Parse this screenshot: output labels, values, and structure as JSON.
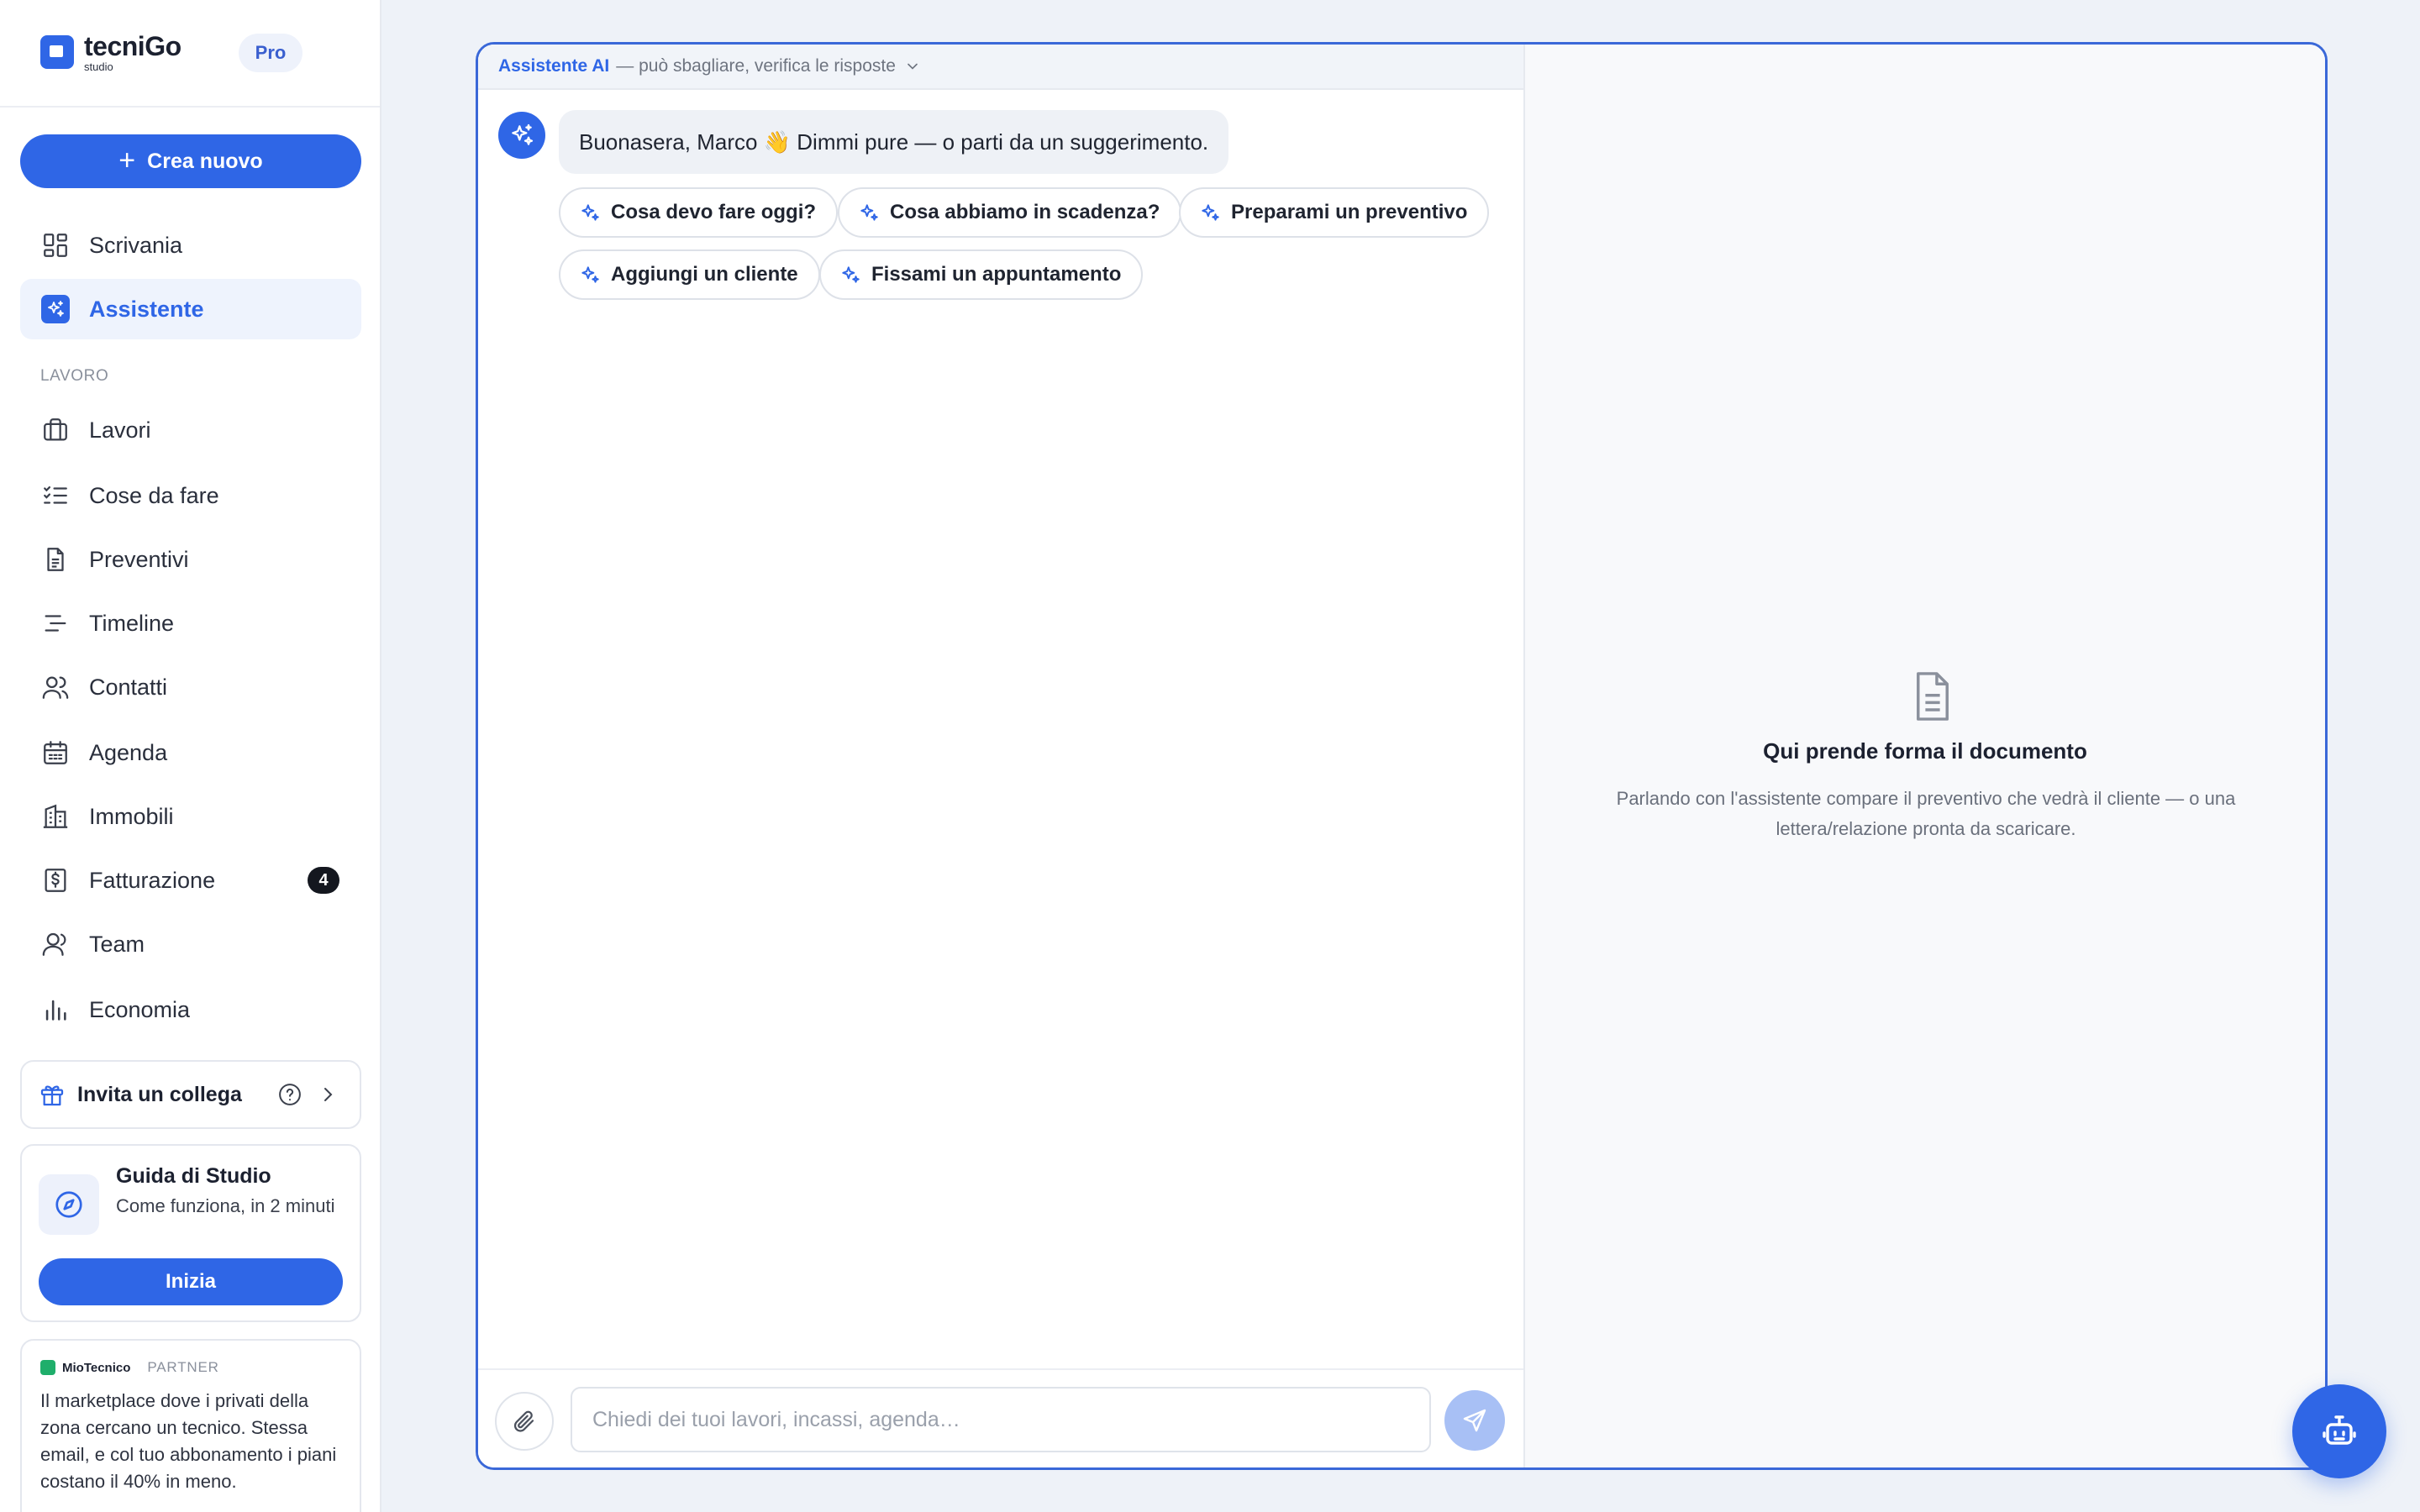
{
  "brand": {
    "name": "tecniGo",
    "sub": "studio",
    "plan": "Pro"
  },
  "sidebar": {
    "create_label": "Crea nuovo",
    "top_items": [
      {
        "label": "Scrivania",
        "icon": "dashboard-icon"
      },
      {
        "label": "Assistente",
        "icon": "sparkles-icon",
        "active": true
      }
    ],
    "section_label": "LAVORO",
    "items": [
      {
        "label": "Lavori",
        "icon": "briefcase-icon"
      },
      {
        "label": "Cose da fare",
        "icon": "checklist-icon"
      },
      {
        "label": "Preventivi",
        "icon": "document-icon"
      },
      {
        "label": "Timeline",
        "icon": "timeline-icon"
      },
      {
        "label": "Contatti",
        "icon": "contacts-icon"
      },
      {
        "label": "Agenda",
        "icon": "calendar-icon"
      },
      {
        "label": "Immobili",
        "icon": "building-icon"
      },
      {
        "label": "Fatturazione",
        "icon": "invoice-icon",
        "badge": "4"
      },
      {
        "label": "Team",
        "icon": "team-icon"
      },
      {
        "label": "Economia",
        "icon": "bar-chart-icon"
      }
    ],
    "invite": {
      "label": "Invita un collega"
    },
    "guide": {
      "title": "Guida di Studio",
      "desc": "Come funziona, in 2 minuti",
      "button": "Inizia"
    },
    "partner": {
      "brand": "MioTecnico",
      "tag": "PARTNER",
      "text": "Il marketplace dove i privati della zona cercano un tecnico. Stessa email, e col tuo abbonamento i piani costano il 40% in meno."
    }
  },
  "chat": {
    "title": "Assistente AI",
    "subtitle": "— può sbagliare, verifica le risposte",
    "greeting": "Buonasera, Marco 👋 Dimmi pure — o parti da un suggerimento.",
    "suggestions": [
      "Cosa devo fare oggi?",
      "Cosa abbiamo in scadenza?",
      "Preparami un preventivo",
      "Aggiungi un cliente",
      "Fissami un appuntamento"
    ],
    "input_placeholder": "Chiedi dei tuoi lavori, incassi, agenda…"
  },
  "document": {
    "title": "Qui prende forma il documento",
    "desc": "Parlando con l'assistente compare il preventivo che vedrà il cliente — o una lettera/relazione pronta da scaricare."
  },
  "colors": {
    "accent": "#2f66e6",
    "background": "#eef2f8",
    "badge": "#14171f",
    "partner": "#1fae6b"
  }
}
